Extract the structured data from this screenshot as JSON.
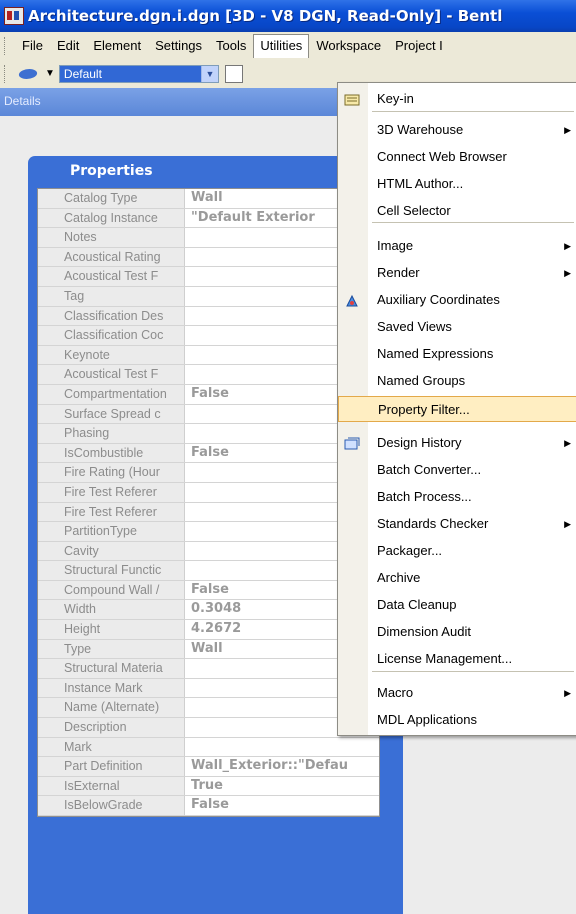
{
  "window": {
    "title": "Architecture.dgn.i.dgn [3D - V8 DGN, Read-Only] - Bentl"
  },
  "menubar": {
    "items": [
      "File",
      "Edit",
      "Element",
      "Settings",
      "Tools",
      "Utilities",
      "Workspace",
      "Project I"
    ]
  },
  "toolbar": {
    "level_value": "Default"
  },
  "details": {
    "label": "Details"
  },
  "properties": {
    "title": "Properties",
    "rows": [
      {
        "name": "Catalog Type",
        "value": "Wall"
      },
      {
        "name": "Catalog Instance",
        "value": "\"Default Exterior"
      },
      {
        "name": "Notes",
        "value": ""
      },
      {
        "name": "Acoustical Rating",
        "value": ""
      },
      {
        "name": "Acoustical Test F",
        "value": ""
      },
      {
        "name": "Tag",
        "value": ""
      },
      {
        "name": "Classification Des",
        "value": ""
      },
      {
        "name": "Classification Coc",
        "value": ""
      },
      {
        "name": "Keynote",
        "value": ""
      },
      {
        "name": "Acoustical Test F",
        "value": ""
      },
      {
        "name": "Compartmentation",
        "value": "False"
      },
      {
        "name": "Surface Spread c",
        "value": ""
      },
      {
        "name": "Phasing",
        "value": ""
      },
      {
        "name": "IsCombustible",
        "value": "False"
      },
      {
        "name": "Fire Rating (Hour",
        "value": ""
      },
      {
        "name": "Fire Test Referer",
        "value": ""
      },
      {
        "name": "Fire Test Referer",
        "value": ""
      },
      {
        "name": "PartitionType",
        "value": ""
      },
      {
        "name": "Cavity",
        "value": ""
      },
      {
        "name": "Structural Functic",
        "value": ""
      },
      {
        "name": "Compound Wall /",
        "value": "False"
      },
      {
        "name": "Width",
        "value": "0.3048"
      },
      {
        "name": "Height",
        "value": "4.2672"
      },
      {
        "name": "Type",
        "value": "Wall"
      },
      {
        "name": "Structural Materia",
        "value": ""
      },
      {
        "name": "Instance Mark",
        "value": ""
      },
      {
        "name": "Name (Alternate)",
        "value": ""
      },
      {
        "name": "Description",
        "value": ""
      },
      {
        "name": "Mark",
        "value": ""
      },
      {
        "name": "Part Definition",
        "value": "Wall_Exterior::\"Defau"
      },
      {
        "name": "IsExternal",
        "value": "True"
      },
      {
        "name": "IsBelowGrade",
        "value": "False"
      }
    ]
  },
  "utilities_menu": {
    "items": [
      {
        "label": "Key-in",
        "icon": "keyin-icon"
      },
      {
        "label": "3D Warehouse",
        "submenu": true
      },
      {
        "label": "Connect Web Browser"
      },
      {
        "label": "HTML Author..."
      },
      {
        "label": "Cell Selector"
      },
      {
        "label": "Image",
        "submenu": true
      },
      {
        "label": "Render",
        "submenu": true
      },
      {
        "label": "Auxiliary Coordinates",
        "icon": "auxiliary-coordinates-icon"
      },
      {
        "label": "Saved Views"
      },
      {
        "label": "Named Expressions"
      },
      {
        "label": "Named Groups"
      },
      {
        "label": "Property Filter...",
        "highlighted": true
      },
      {
        "label": "Design History",
        "submenu": true,
        "icon": "design-history-icon"
      },
      {
        "label": "Batch Converter..."
      },
      {
        "label": "Batch Process..."
      },
      {
        "label": "Standards Checker",
        "submenu": true
      },
      {
        "label": "Packager..."
      },
      {
        "label": "Archive"
      },
      {
        "label": "Data Cleanup"
      },
      {
        "label": "Dimension Audit"
      },
      {
        "label": "License Management..."
      },
      {
        "label": "Macro",
        "submenu": true
      },
      {
        "label": "MDL Applications"
      }
    ]
  }
}
